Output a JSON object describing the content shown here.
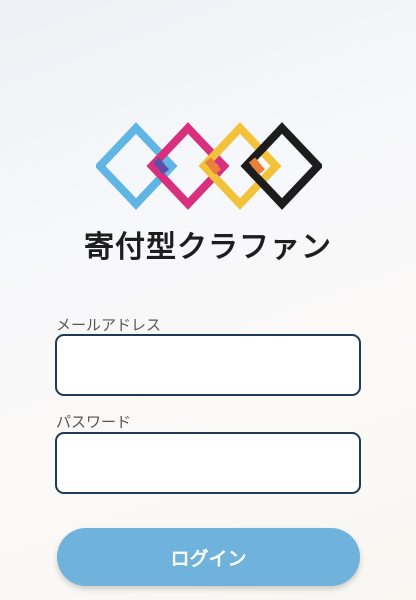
{
  "brand": {
    "name": "寄付型クラファン",
    "logo_icon": "chain-link-diamonds-logo-icon",
    "logo_colors": [
      "#5fb6e4",
      "#d9307e",
      "#f2c23b",
      "#1c1c1c"
    ]
  },
  "login_form": {
    "email_label": "メールアドレス",
    "email_value": "",
    "password_label": "パスワード",
    "password_value": "",
    "submit_label": "ログイン"
  },
  "colors": {
    "button_bg": "#6fb3dc",
    "field_border": "#1f3a56"
  }
}
